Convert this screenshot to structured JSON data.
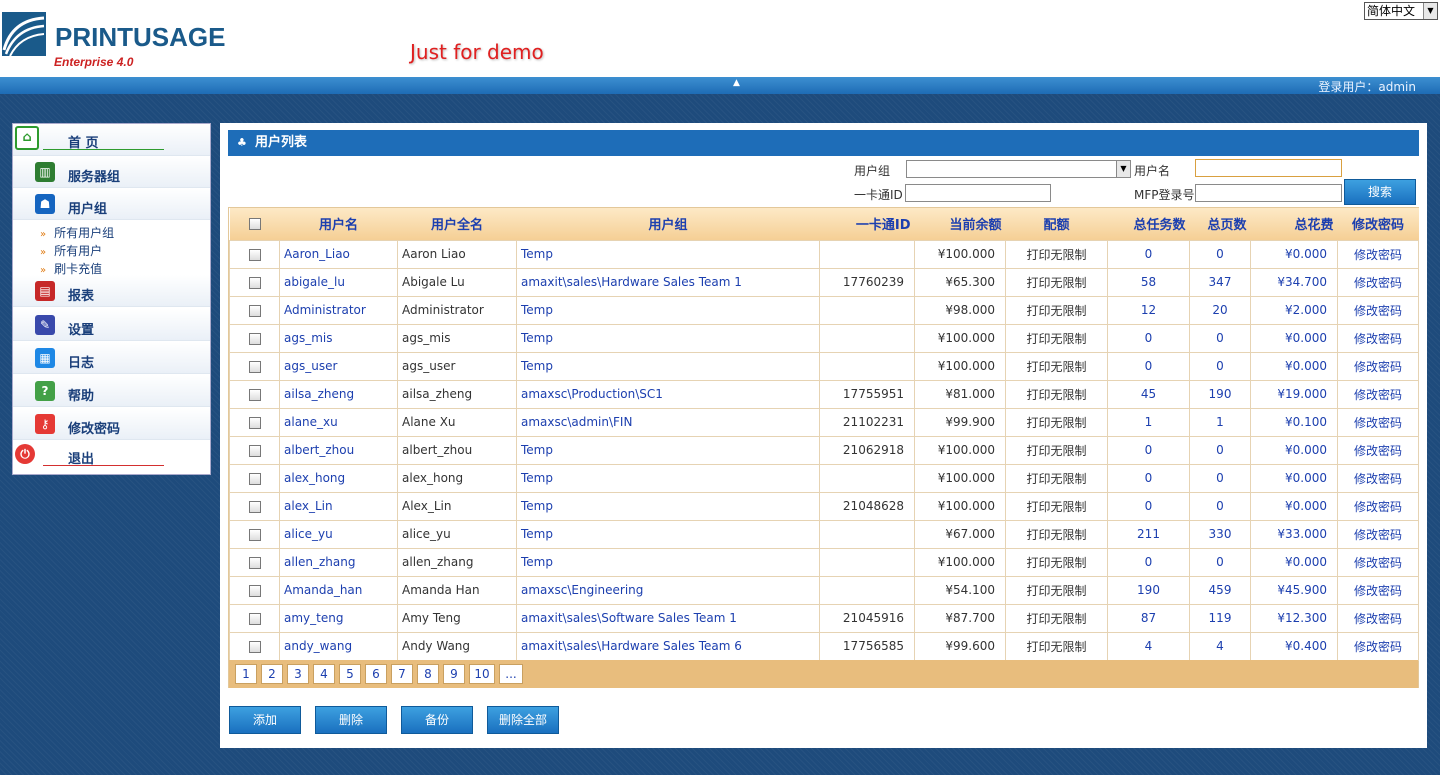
{
  "header": {
    "logo_main": "PRINTUSAGE",
    "logo_sub": "Enterprise 4.0",
    "demo_text": "Just for demo",
    "language": "简体中文",
    "login_label": "登录用户：",
    "login_user": "admin"
  },
  "sidebar": {
    "items": [
      {
        "label": "首 页",
        "icon": "home-icon",
        "color": "#2e9b2e"
      },
      {
        "label": "服务器组",
        "icon": "server-group-icon",
        "color": "#2e7d32"
      },
      {
        "label": "用户组",
        "icon": "users-icon",
        "color": "#1565c0"
      },
      {
        "label": "报表",
        "icon": "report-icon",
        "color": "#c62828"
      },
      {
        "label": "设置",
        "icon": "settings-icon",
        "color": "#3949ab"
      },
      {
        "label": "日志",
        "icon": "log-icon",
        "color": "#1e88e5"
      },
      {
        "label": "帮助",
        "icon": "help-icon",
        "color": "#43a047"
      },
      {
        "label": "修改密码",
        "icon": "key-icon",
        "color": "#e53935"
      },
      {
        "label": "退出",
        "icon": "power-icon",
        "color": "#e53935"
      }
    ],
    "subitems": [
      "所有用户组",
      "所有用户",
      "刷卡充值"
    ]
  },
  "panel": {
    "title": "用户列表"
  },
  "filters": {
    "group_label": "用户组",
    "group_value": "",
    "username_label": "用户名",
    "username_value": "",
    "card_label": "一卡通ID",
    "card_value": "",
    "mfp_label": "MFP登录号",
    "mfp_value": "",
    "search_button": "搜索"
  },
  "table": {
    "headers": [
      "用户名",
      "用户全名",
      "用户组",
      "一卡通ID",
      "当前余额",
      "配额",
      "总任务数",
      "总页数",
      "总花费",
      "修改密码"
    ],
    "rows": [
      {
        "username": "Aaron_Liao",
        "fullname": "Aaron Liao",
        "group": "Temp",
        "card": "",
        "balance": "¥100.000",
        "quota": "打印无限制",
        "jobs": "0",
        "pages": "0",
        "cost": "¥0.000",
        "action": "修改密码"
      },
      {
        "username": "abigale_lu",
        "fullname": "Abigale Lu",
        "group": "amaxit\\sales\\Hardware Sales Team 1",
        "card": "17760239",
        "balance": "¥65.300",
        "quota": "打印无限制",
        "jobs": "58",
        "pages": "347",
        "cost": "¥34.700",
        "action": "修改密码"
      },
      {
        "username": "Administrator",
        "fullname": "Administrator",
        "group": "Temp",
        "card": "",
        "balance": "¥98.000",
        "quota": "打印无限制",
        "jobs": "12",
        "pages": "20",
        "cost": "¥2.000",
        "action": "修改密码"
      },
      {
        "username": "ags_mis",
        "fullname": "ags_mis",
        "group": "Temp",
        "card": "",
        "balance": "¥100.000",
        "quota": "打印无限制",
        "jobs": "0",
        "pages": "0",
        "cost": "¥0.000",
        "action": "修改密码"
      },
      {
        "username": "ags_user",
        "fullname": "ags_user",
        "group": "Temp",
        "card": "",
        "balance": "¥100.000",
        "quota": "打印无限制",
        "jobs": "0",
        "pages": "0",
        "cost": "¥0.000",
        "action": "修改密码"
      },
      {
        "username": "ailsa_zheng",
        "fullname": "ailsa_zheng",
        "group": "amaxsc\\Production\\SC1",
        "card": "17755951",
        "balance": "¥81.000",
        "quota": "打印无限制",
        "jobs": "45",
        "pages": "190",
        "cost": "¥19.000",
        "action": "修改密码"
      },
      {
        "username": "alane_xu",
        "fullname": "Alane Xu",
        "group": "amaxsc\\admin\\FIN",
        "card": "21102231",
        "balance": "¥99.900",
        "quota": "打印无限制",
        "jobs": "1",
        "pages": "1",
        "cost": "¥0.100",
        "action": "修改密码"
      },
      {
        "username": "albert_zhou",
        "fullname": "albert_zhou",
        "group": "Temp",
        "card": "21062918",
        "balance": "¥100.000",
        "quota": "打印无限制",
        "jobs": "0",
        "pages": "0",
        "cost": "¥0.000",
        "action": "修改密码"
      },
      {
        "username": "alex_hong",
        "fullname": "alex_hong",
        "group": "Temp",
        "card": "",
        "balance": "¥100.000",
        "quota": "打印无限制",
        "jobs": "0",
        "pages": "0",
        "cost": "¥0.000",
        "action": "修改密码"
      },
      {
        "username": "alex_Lin",
        "fullname": "Alex_Lin",
        "group": "Temp",
        "card": "21048628",
        "balance": "¥100.000",
        "quota": "打印无限制",
        "jobs": "0",
        "pages": "0",
        "cost": "¥0.000",
        "action": "修改密码"
      },
      {
        "username": "alice_yu",
        "fullname": "alice_yu",
        "group": "Temp",
        "card": "",
        "balance": "¥67.000",
        "quota": "打印无限制",
        "jobs": "211",
        "pages": "330",
        "cost": "¥33.000",
        "action": "修改密码"
      },
      {
        "username": "allen_zhang",
        "fullname": "allen_zhang",
        "group": "Temp",
        "card": "",
        "balance": "¥100.000",
        "quota": "打印无限制",
        "jobs": "0",
        "pages": "0",
        "cost": "¥0.000",
        "action": "修改密码"
      },
      {
        "username": "Amanda_han",
        "fullname": "Amanda Han",
        "group": "amaxsc\\Engineering",
        "card": "",
        "balance": "¥54.100",
        "quota": "打印无限制",
        "jobs": "190",
        "pages": "459",
        "cost": "¥45.900",
        "action": "修改密码"
      },
      {
        "username": "amy_teng",
        "fullname": "Amy Teng",
        "group": "amaxit\\sales\\Software Sales Team 1",
        "card": "21045916",
        "balance": "¥87.700",
        "quota": "打印无限制",
        "jobs": "87",
        "pages": "119",
        "cost": "¥12.300",
        "action": "修改密码"
      },
      {
        "username": "andy_wang",
        "fullname": "Andy Wang",
        "group": "amaxit\\sales\\Hardware Sales Team 6",
        "card": "17756585",
        "balance": "¥99.600",
        "quota": "打印无限制",
        "jobs": "4",
        "pages": "4",
        "cost": "¥0.400",
        "action": "修改密码"
      }
    ]
  },
  "pagination": [
    "1",
    "2",
    "3",
    "4",
    "5",
    "6",
    "7",
    "8",
    "9",
    "10",
    "..."
  ],
  "actions": {
    "add": "添加",
    "delete": "删除",
    "backup": "备份",
    "delete_all": "删除全部"
  }
}
